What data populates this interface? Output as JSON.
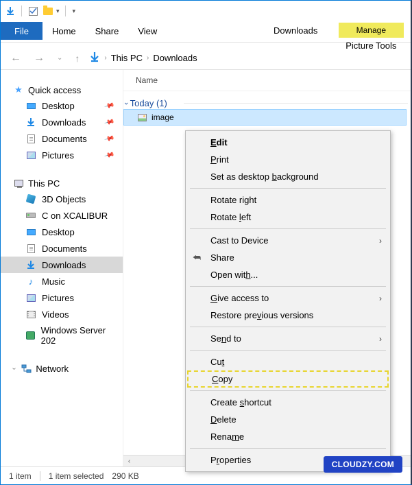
{
  "titlebar": {},
  "ribbon": {
    "file": "File",
    "tabs": [
      "Home",
      "Share",
      "View"
    ],
    "contextual_label": "Manage",
    "contextual_sub": "Picture Tools",
    "right_label": "Downloads"
  },
  "breadcrumb": {
    "root": "This PC",
    "current": "Downloads"
  },
  "sidebar": {
    "quick_access": {
      "label": "Quick access",
      "items": [
        {
          "label": "Desktop",
          "pinned": true
        },
        {
          "label": "Downloads",
          "pinned": true
        },
        {
          "label": "Documents",
          "pinned": true
        },
        {
          "label": "Pictures",
          "pinned": true
        }
      ]
    },
    "this_pc": {
      "label": "This PC",
      "items": [
        {
          "label": "3D Objects"
        },
        {
          "label": "C on XCALIBUR"
        },
        {
          "label": "Desktop"
        },
        {
          "label": "Documents"
        },
        {
          "label": "Downloads",
          "active": true
        },
        {
          "label": "Music"
        },
        {
          "label": "Pictures"
        },
        {
          "label": "Videos"
        },
        {
          "label": "Windows Server 202"
        }
      ]
    },
    "network": {
      "label": "Network"
    }
  },
  "content": {
    "column_header": "Name",
    "group_label": "Today (1)",
    "file_name": "image"
  },
  "context_menu": {
    "edit": "Edit",
    "print": "Print",
    "set_bg": "Set as desktop background",
    "rotate_r": "Rotate right",
    "rotate_l": "Rotate left",
    "cast": "Cast to Device",
    "share": "Share",
    "open_with": "Open with...",
    "give_access": "Give access to",
    "restore": "Restore previous versions",
    "send_to": "Send to",
    "cut": "Cut",
    "copy": "Copy",
    "shortcut": "Create shortcut",
    "delete": "Delete",
    "rename": "Rename",
    "properties": "Properties"
  },
  "status": {
    "count": "1 item",
    "selection": "1 item selected",
    "size": "290 KB"
  },
  "watermark": "CLOUDZY.COM"
}
